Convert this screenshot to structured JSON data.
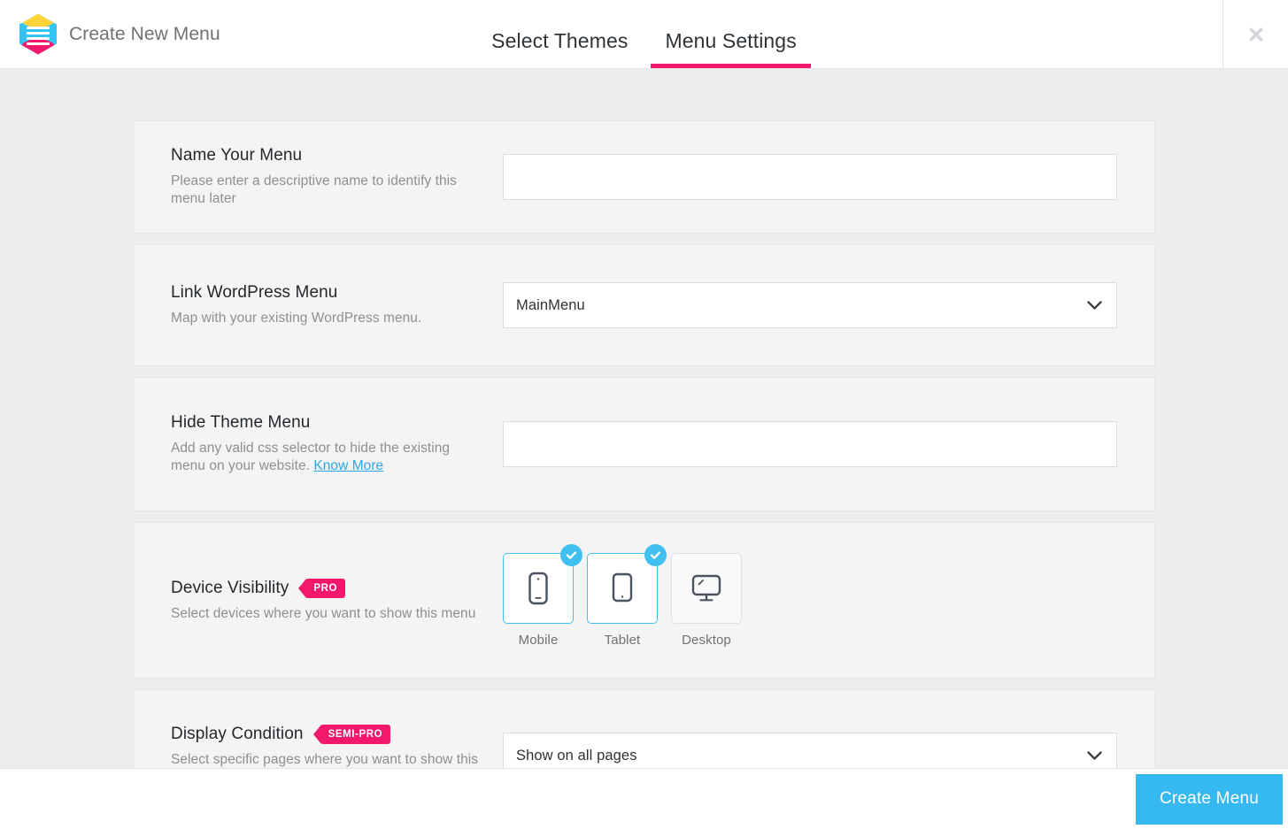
{
  "header": {
    "brand_title": "Create New Menu",
    "logo_icon": "menu-hexagon-logo",
    "close_icon": "close-icon",
    "tabs": [
      {
        "label": "Select Themes",
        "active": false
      },
      {
        "label": "Menu Settings",
        "active": true
      }
    ],
    "active_tab_color": "#f4186d"
  },
  "sections": {
    "name_menu": {
      "title": "Name Your Menu",
      "description": "Please enter a descriptive name to identify this menu later",
      "input_value": "",
      "input_placeholder": ""
    },
    "link_menu": {
      "title": "Link WordPress Menu",
      "description": "Map with your existing WordPress menu.",
      "selected_option": "MainMenu",
      "caret_icon": "chevron-down-icon"
    },
    "hide_menu": {
      "title": "Hide Theme Menu",
      "description": "Add any valid css selector to hide the existing menu on your website.",
      "link_label": "Know More",
      "link_color": "#2ba7e8",
      "input_value": "",
      "input_placeholder": ""
    },
    "device_visibility": {
      "title": "Device Visibility",
      "badge": "PRO",
      "badge_color": "#f4186d",
      "description": "Select devices where you want to show this menu",
      "devices": [
        {
          "label": "Mobile",
          "icon": "mobile-icon",
          "selected": true
        },
        {
          "label": "Tablet",
          "icon": "tablet-icon",
          "selected": true
        },
        {
          "label": "Desktop",
          "icon": "desktop-icon",
          "selected": false
        }
      ],
      "check_icon": "check-circle-icon",
      "selected_color": "#3fc0f0"
    },
    "display_condition": {
      "title": "Display Condition",
      "badge": "SEMI-PRO",
      "badge_color": "#f4186d",
      "description": "Select specific pages where you want to show this menu.",
      "selected_option": "Show on all pages",
      "caret_icon": "chevron-down-icon"
    }
  },
  "footer": {
    "create_label": "Create Menu",
    "create_color": "#36b9f0"
  }
}
